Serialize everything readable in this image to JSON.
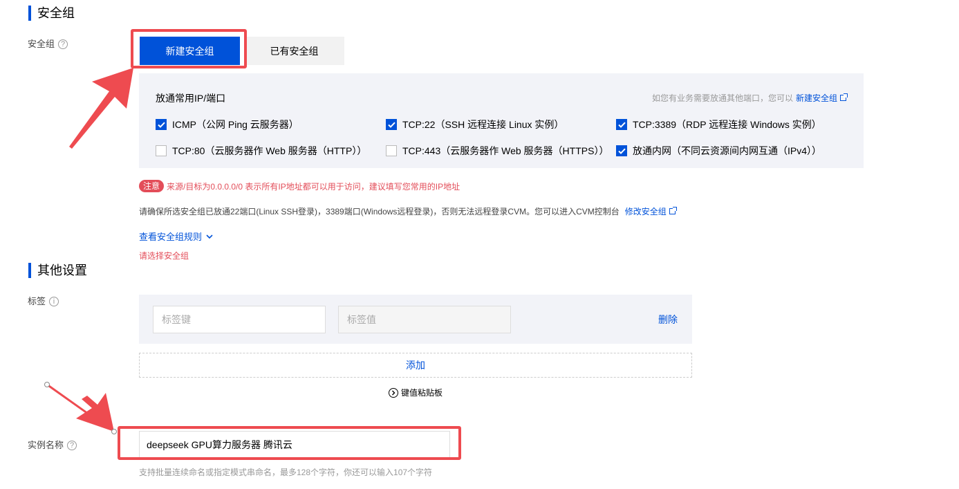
{
  "security_section": {
    "title": "安全组",
    "label": "安全组",
    "tabs": [
      "新建安全组",
      "已有安全组"
    ],
    "panel_title": "放通常用IP/端口",
    "panel_hint": "如您有业务需要放通其他端口，您可以",
    "panel_hint_link": "新建安全组",
    "ports": [
      {
        "label": "ICMP（公网 Ping 云服务器）",
        "checked": true
      },
      {
        "label": "TCP:22（SSH 远程连接 Linux 实例）",
        "checked": true
      },
      {
        "label": "TCP:3389（RDP 远程连接 Windows 实例）",
        "checked": true
      },
      {
        "label": "TCP:80（云服务器作 Web 服务器（HTTP））",
        "checked": false
      },
      {
        "label": "TCP:443（云服务器作 Web 服务器（HTTPS））",
        "checked": false
      },
      {
        "label": "放通内网（不同云资源间内网互通（IPv4））",
        "checked": true
      }
    ],
    "notice_badge": "注意",
    "notice_text": "来源/目标为0.0.0.0/0 表示所有IP地址都可以用于访问，建议填写您常用的IP地址",
    "info_text": "请确保所选安全组已放通22端口(Linux SSH登录)，3389端口(Windows远程登录)，否则无法远程登录CVM。您可以进入CVM控制台",
    "info_link": "修改安全组",
    "view_rules": "查看安全组规则",
    "error_text": "请选择安全组"
  },
  "other_section": {
    "title": "其他设置",
    "tag_label": "标签",
    "tag_key_placeholder": "标签键",
    "tag_value_placeholder": "标签值",
    "delete_label": "删除",
    "add_label": "添加",
    "paste_label": "键值粘贴板",
    "instance_label": "实例名称",
    "instance_value": "deepseek GPU算力服务器 腾讯云",
    "instance_hint": "支持批量连续命名或指定模式串命名，最多128个字符，你还可以输入107个字符"
  },
  "colors": {
    "primary": "#0052d9",
    "annotation_red": "#ee4b50",
    "panel_bg": "#f2f3f8",
    "notice_red": "#e34d59"
  }
}
